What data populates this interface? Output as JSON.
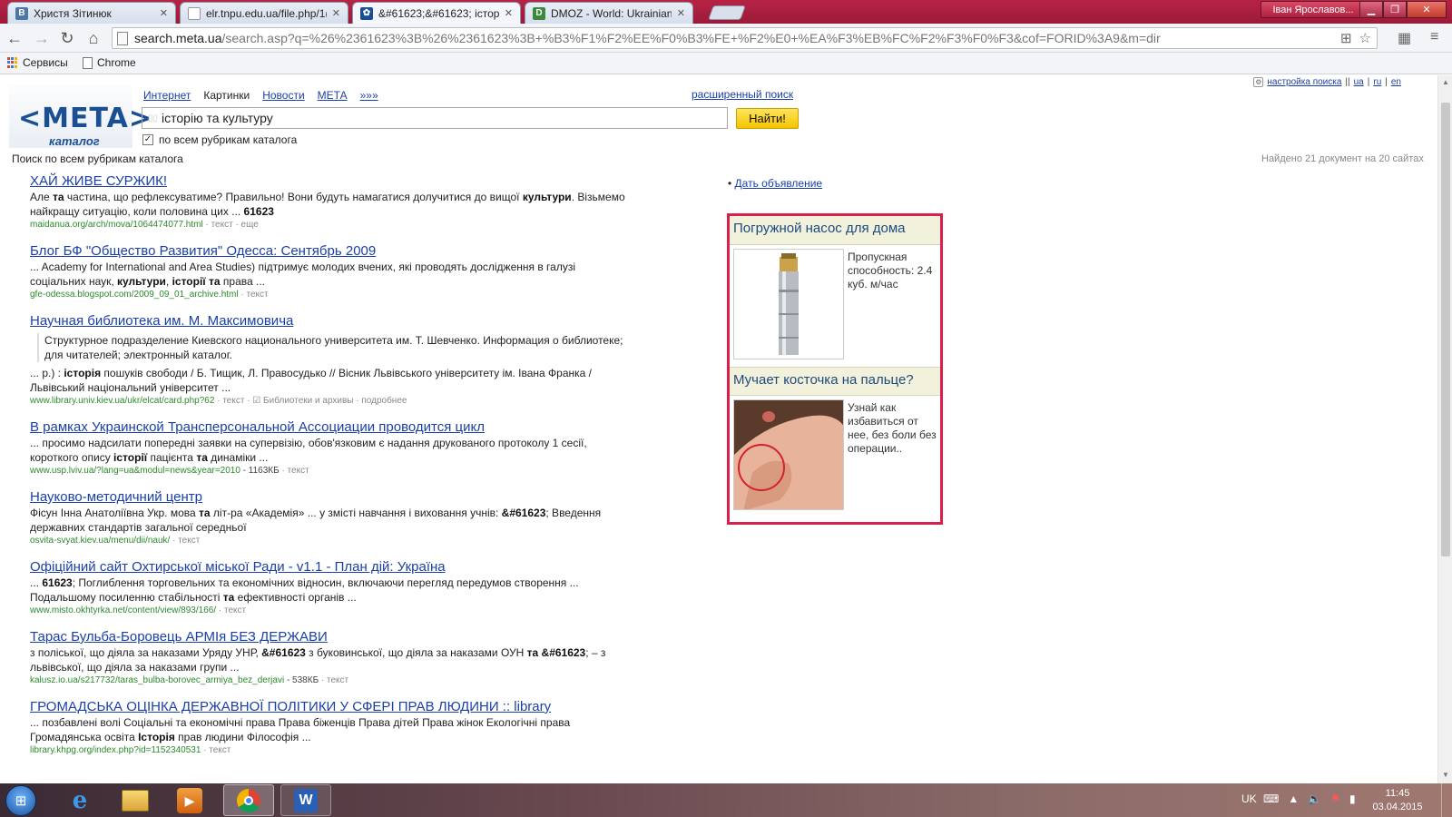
{
  "browser": {
    "tabs": [
      {
        "title": "Христя Зітинюк",
        "icon": "vk-icon",
        "color": "#4a76a8"
      },
      {
        "title": "elr.tnpu.edu.ua/file.php/1(",
        "icon": "page-icon",
        "color": "#888888"
      },
      {
        "title": "&#61623;&#61623; історі",
        "icon": "meta-icon",
        "color": "#1b4f94"
      },
      {
        "title": "DMOZ - World: Ukrainian",
        "icon": "dmoz-icon",
        "color": "#3a8a3a"
      }
    ],
    "user": "Іван Ярославов...",
    "url_host": "search.meta.ua",
    "url_path": "/search.asp?q=%26%2361623%3B%26%2361623%3B+%B3%F1%F2%EE%F0%B3%FE+%F2%E0+%EA%F3%EB%FC%F2%F3%F0%F3&cof=FORID%3A9&m=dir",
    "bookmarks": [
      "Сервисы",
      "Chrome"
    ]
  },
  "search": {
    "logo": "<META>",
    "logo_sub": "каталог",
    "tabs": [
      "Интернет",
      "Картинки",
      "Новости",
      "МЕТА",
      "»»»"
    ],
    "advanced": "расширенный поиск",
    "query": "історію та культуру",
    "button": "Найти!",
    "checkbox_label": "по всем рубрикам каталога",
    "settings": "настройка поиска",
    "lang": [
      "ua",
      "ru",
      "en"
    ],
    "found_left": "Поиск по всем рубрикам каталога",
    "found_right": "Найдено 21 документ на 20 сайтах"
  },
  "ads": {
    "link": "Дать объявление",
    "items": [
      {
        "title": "Погружной насос для дома",
        "text": "Пропускная способность: 2.4 куб. м/час"
      },
      {
        "title": "Мучает косточка на пальце?",
        "text": "Узнай как избавиться от нее, без боли без операции.."
      }
    ]
  },
  "taskbar": {
    "lang": "UK",
    "time": "11:45",
    "date": "03.04.2015"
  }
}
